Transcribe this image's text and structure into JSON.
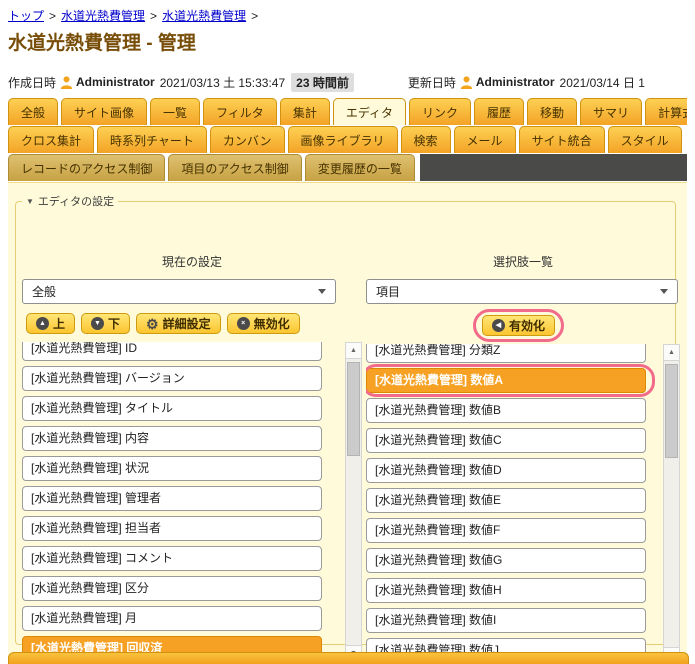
{
  "breadcrumb": {
    "separator": ">",
    "items": [
      "トップ",
      "水道光熱費管理",
      "水道光熱費管理"
    ]
  },
  "page": {
    "title": "水道光熱費管理 - 管理"
  },
  "meta": {
    "created_label": "作成日時",
    "created_user": "Administrator",
    "created_at": "2021/03/13 土 15:33:47",
    "created_ago": "23 時間前",
    "updated_label": "更新日時",
    "updated_user": "Administrator",
    "updated_at": "2021/03/14 日 1"
  },
  "tabs": {
    "row1": [
      "全般",
      "サイト画像",
      "一覧",
      "フィルタ",
      "集計",
      "エディタ",
      "リンク",
      "履歴",
      "移動",
      "サマリ",
      "計算式"
    ],
    "row2": [
      "クロス集計",
      "時系列チャート",
      "カンバン",
      "画像ライブラリ",
      "検索",
      "メール",
      "サイト統合",
      "スタイル"
    ],
    "row3": [
      "レコードのアクセス制御",
      "項目のアクセス制御",
      "変更履歴の一覧"
    ],
    "active": "エディタ"
  },
  "editor": {
    "legend": "エディタの設定",
    "current": {
      "heading": "現在の設定",
      "select_value": "全般",
      "buttons": {
        "up": "上",
        "down": "下",
        "detail": "詳細設定",
        "disable": "無効化"
      },
      "items": [
        "[水道光熱費管理] ID",
        "[水道光熱費管理] バージョン",
        "[水道光熱費管理] タイトル",
        "[水道光熱費管理] 内容",
        "[水道光熱費管理] 状況",
        "[水道光熱費管理] 管理者",
        "[水道光熱費管理] 担当者",
        "[水道光熱費管理] コメント",
        "[水道光熱費管理] 区分",
        "[水道光熱費管理] 月",
        "[水道光熱費管理] 回収済"
      ],
      "selected_item": "[水道光熱費管理] 回収済"
    },
    "choices": {
      "heading": "選択肢一覧",
      "select_value": "項目",
      "enable_button": "有効化",
      "items": [
        "[水道光熱費管理] 分類Z",
        "[水道光熱費管理] 数値A",
        "[水道光熱費管理] 数値B",
        "[水道光熱費管理] 数値C",
        "[水道光熱費管理] 数値D",
        "[水道光熱費管理] 数値E",
        "[水道光熱費管理] 数値F",
        "[水道光熱費管理] 数値G",
        "[水道光熱費管理] 数値H",
        "[水道光熱費管理] 数値I",
        "[水道光熱費管理] 数値J"
      ],
      "selected_item": "[水道光熱費管理] 数値A"
    }
  },
  "icons": {
    "triangle_up": "▲",
    "triangle_down": "▼",
    "triangle_left": "◀",
    "gear": "⚙",
    "cancel": "×",
    "collapse": "▼",
    "scroll_up": "▲",
    "scroll_down": "▼"
  },
  "colors": {
    "tab_orange": "#f3a326",
    "selected_item_orange": "#f6a124",
    "annotation_pink": "#f26b8a",
    "content_bg": "#fffbda",
    "title_brown": "#774d07",
    "link_blue": "#0000cc"
  }
}
